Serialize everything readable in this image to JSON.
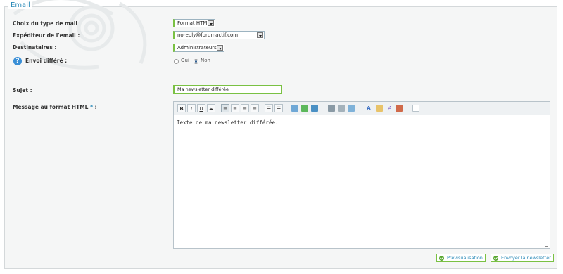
{
  "section": {
    "title": "Email"
  },
  "fields": {
    "mail_type": {
      "label": "Choix du type de mail",
      "value": "Format HTML"
    },
    "sender": {
      "label": "Expéditeur de l'email :",
      "value": "noreply@forumactif.com"
    },
    "recipients": {
      "label": "Destinataires :",
      "value": "Administrateurs"
    },
    "delayed": {
      "label": "Envoi différé :",
      "options": [
        "Oui",
        "Non"
      ],
      "selected": "Non"
    },
    "subject": {
      "label": "Sujet :",
      "value": "Ma newsletter différée"
    },
    "message": {
      "label": "Message au format HTML",
      "required_mark": "*",
      "label_suffix": " :",
      "content": "Texte de ma newsletter différée."
    }
  },
  "toolbar": {
    "bold": "B",
    "italic": "I",
    "underline": "U",
    "strike": "S",
    "align_left": "≡",
    "align_center": "≡",
    "align_right": "≡",
    "justify": "≡",
    "list_bullet": "☰",
    "list_number": "☰",
    "color_font": "A",
    "color_bg": "A"
  },
  "colors": {
    "accent": "#7ac143",
    "title": "#2a8ab8"
  },
  "buttons": {
    "preview": "Prévisualisation",
    "send": "Envoyer la newsletter"
  }
}
